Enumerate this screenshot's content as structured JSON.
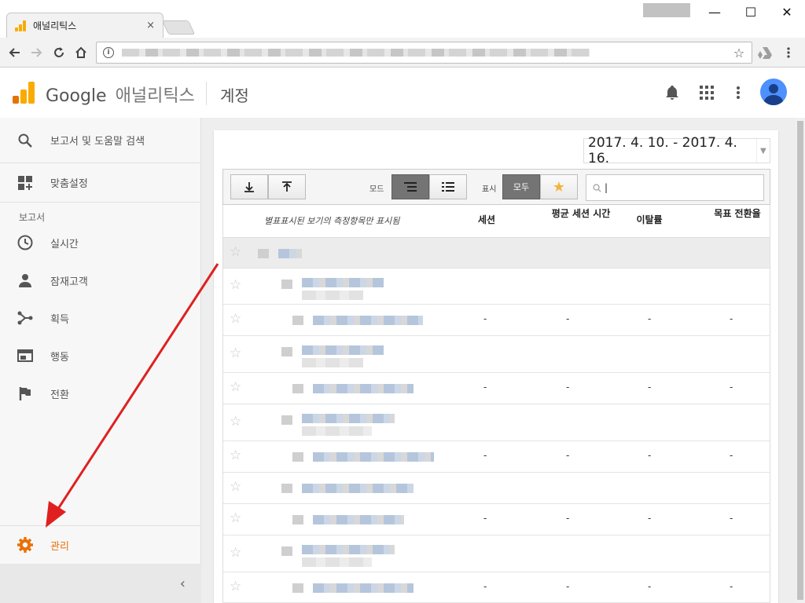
{
  "browser": {
    "tab_title": "애널리틱스",
    "tab_close": "×",
    "window_controls": {
      "minimize": "—",
      "maximize": "☐",
      "close": "✕"
    }
  },
  "header": {
    "brand": "Google",
    "product": "애널리틱스",
    "account": "계정"
  },
  "sidebar": {
    "search_label": "보고서 및 도움말 검색",
    "customization_label": "맞춤설정",
    "section_label": "보고서",
    "items": [
      {
        "label": "실시간",
        "icon": "clock-icon"
      },
      {
        "label": "잠재고객",
        "icon": "person-icon"
      },
      {
        "label": "획득",
        "icon": "acquisition-icon"
      },
      {
        "label": "행동",
        "icon": "behavior-icon"
      },
      {
        "label": "전환",
        "icon": "flag-icon"
      }
    ],
    "admin_label": "관리",
    "collapse": "‹"
  },
  "content": {
    "date_range": "2017. 4. 10. - 2017. 4. 16.",
    "toolbar": {
      "mode_label": "모드",
      "display_label": "표시",
      "all_label": "모두",
      "search_cursor": "|"
    },
    "table": {
      "first_column": "별표표시된 보기의 측정항목만 표시됨",
      "columns": [
        "세션",
        "평균 세션 시간",
        "이탈률",
        "목표 전환율"
      ],
      "dash": "-"
    }
  },
  "colors": {
    "accent": "#e8710a",
    "arrow": "#e02020",
    "blurred_link": "#b5c6dc"
  }
}
